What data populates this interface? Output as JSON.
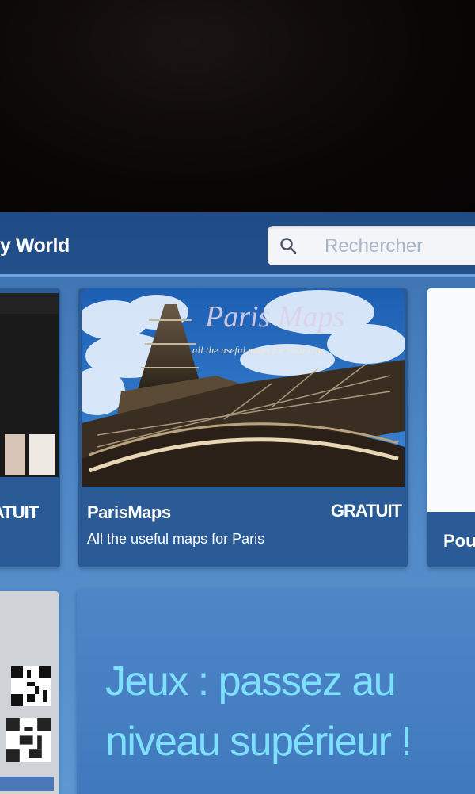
{
  "header": {
    "title": "y World",
    "search": {
      "placeholder": "Rechercher"
    }
  },
  "cards": {
    "left_partial": {
      "price": "ATUIT"
    },
    "featured": {
      "name": "ParisMaps",
      "price": "GRATUIT",
      "description": "All the useful maps for Paris",
      "hero_title": "Paris Maps",
      "hero_tagline": "all the useful maps for your trip"
    },
    "right_partial": {
      "label": "Pou"
    }
  },
  "promo": {
    "text": "Jeux : passez au\nniveau supérieur !"
  },
  "colors": {
    "topbar": "#234f8a",
    "card": "#2a5b97",
    "promo_text": "#7ee0ff"
  },
  "icons": {
    "search": "search-icon"
  }
}
